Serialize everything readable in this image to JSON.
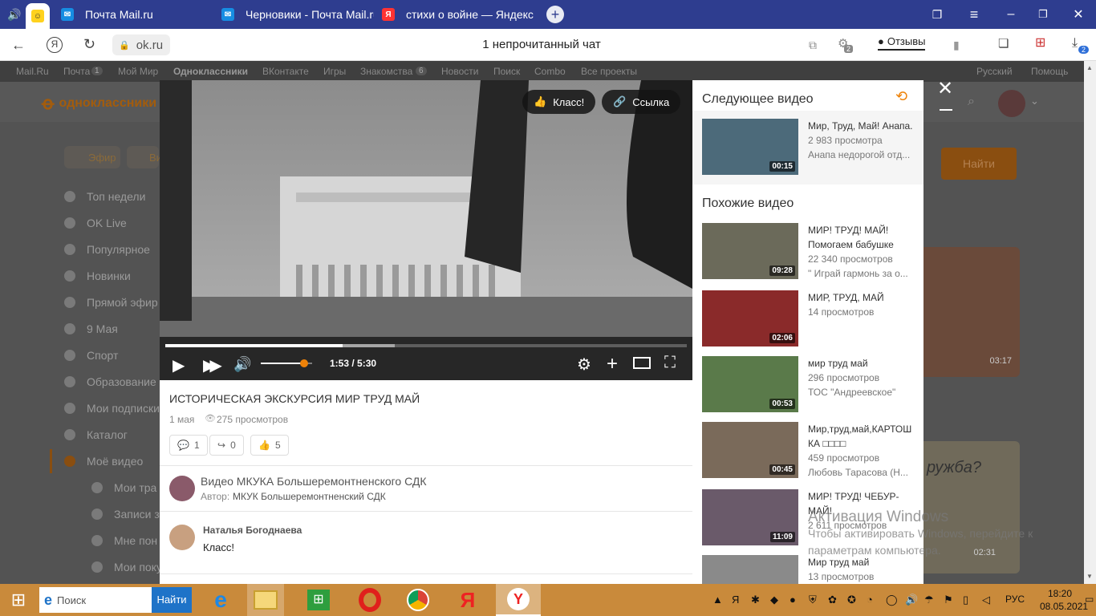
{
  "browser": {
    "tabs": [
      {
        "title": "Почта Mail.ru",
        "icon": "mail-icon"
      },
      {
        "title": "Черновики - Почта Mail.ru",
        "icon": "mail-icon"
      },
      {
        "title": "стихи о войне — Яндекс: н",
        "icon": "yandex-icon"
      }
    ],
    "address": "ok.ru",
    "page_title": "1 непрочитанный чат",
    "reviews_label": "Отзывы",
    "badge_tabs": "2",
    "badge_downloads": "2"
  },
  "portal": {
    "items": [
      "Mail.Ru",
      "Почта",
      "Мой Мир",
      "Одноклассники",
      "ВКонтакте",
      "Игры",
      "Знакомства",
      "Новости",
      "Поиск",
      "Combo",
      "Все проекты"
    ],
    "mail_count": "1",
    "dating_count": "6",
    "language": "Русский",
    "help": "Помощь"
  },
  "ok": {
    "logo_text": "одноклассники",
    "login_button": "Найти",
    "tabs": [
      "Эфир",
      "Ви"
    ],
    "sidebar": [
      "Топ недели",
      "OK Live",
      "Популярное",
      "Новинки",
      "Прямой эфир",
      "9 Мая",
      "Спорт",
      "Образование",
      "Мои подписки",
      "Каталог",
      "Моё видео"
    ],
    "sub_sidebar": [
      "Мои тра",
      "Записи з",
      "Мне пон",
      "Мои поку"
    ],
    "bg_durations": [
      "03:17",
      "02:31"
    ],
    "bg_card_text": "ружба?"
  },
  "player": {
    "class_button": "Класс!",
    "link_button": "Ссылка",
    "time": "1:53 / 5:30",
    "progress_percent": 34,
    "buffer_percent": 44,
    "volume_percent": 85
  },
  "video": {
    "title": "ИСТОРИЧЕСКАЯ ЭКСКУРСИЯ МИР ТРУД МАЙ",
    "date": "1 мая",
    "views": "275 просмотров",
    "comments_count": "1",
    "shares_count": "0",
    "likes_count": "5",
    "channel": "Видео МКУКА Большеремонтненского СДК",
    "author_label": "Автор:",
    "author": "МКУК Большеремонтненский СДК",
    "comment_author": "Наталья Богоднаева",
    "comment_text": "Класс!"
  },
  "side": {
    "next_heading": "Следующее видео",
    "next": {
      "title": "Мир, Труд, Май! Анапа.",
      "views": "2 983 просмотра",
      "author": "Анапа недорогой отд...",
      "duration": "00:15"
    },
    "similar_heading": "Похожие видео",
    "similar": [
      {
        "line1": "МИР! ТРУД! МАЙ!",
        "line2": "Помогаем бабушке",
        "views": "22 340 просмотров",
        "author": "\" Играй гармонь за о...",
        "duration": "09:28"
      },
      {
        "line1": "МИР, ТРУД, МАЙ",
        "line2": "",
        "views": "14 просмотров",
        "author": "",
        "duration": "02:06"
      },
      {
        "line1": "мир труд май",
        "line2": "",
        "views": "296 просмотров",
        "author": "ТОС \"Андреевское\"",
        "duration": "00:53"
      },
      {
        "line1": "Мир,труд,май,КАРТОШ",
        "line2": "КА □□□□",
        "views": "459 просмотров",
        "author": "Любовь Тарасова (Н...",
        "duration": "00:45"
      },
      {
        "line1": "МИР! ТРУД! ЧЕБУР-",
        "line2": "МАЙ!",
        "views": "2 611 просмотров",
        "author": "",
        "duration": "11:09"
      },
      {
        "line1": "Мир труд май",
        "line2": "",
        "views": "13 просмотров",
        "author": "",
        "duration": ""
      }
    ]
  },
  "watermark": {
    "line1": "Активация Windows",
    "line2": "Чтобы активировать Windows, перейдите к",
    "line3": "параметрам компьютера."
  },
  "taskbar": {
    "search_placeholder": "Поиск",
    "search_button": "Найти",
    "lang": "РУС",
    "time": "18:20",
    "date": "08.05.2021"
  },
  "colors": {
    "tabbar": "#2e3d8f",
    "ok_orange": "#ee8208",
    "taskbar": "#c98a3b"
  }
}
